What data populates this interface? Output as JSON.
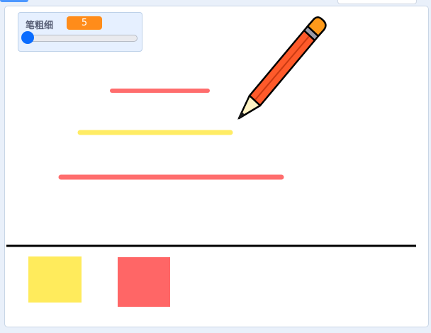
{
  "monitor": {
    "label": "笔粗细",
    "value": "5",
    "slider_fraction": 0.0
  },
  "strokes": [
    {
      "color": "#ff6666"
    },
    {
      "color": "#ffeb5c"
    },
    {
      "color": "#ff6666"
    }
  ],
  "palette": [
    {
      "name": "yellow",
      "color": "#ffeb5c"
    },
    {
      "name": "red",
      "color": "#ff6666"
    }
  ],
  "colors": {
    "monitor_value_bg": "#ff8c1a",
    "slider_thumb": "#0a6cff",
    "pencil_body": "#ff5a2a",
    "pencil_eraser": "#ff9a1a"
  },
  "icons": {
    "pencil": "pencil-icon"
  }
}
